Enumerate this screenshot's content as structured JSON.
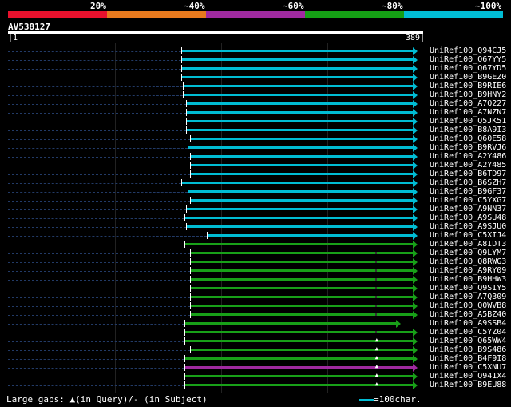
{
  "header": {
    "query_id": "AV538127",
    "start_pos": "1",
    "end_pos": "389",
    "legend": [
      {
        "label": "20%",
        "color": "#e8112d"
      },
      {
        "label": "~40%",
        "color": "#e87a1e"
      },
      {
        "label": "~60%",
        "color": "#a02aa0"
      },
      {
        "label": "~80%",
        "color": "#15a015"
      },
      {
        "label": "~100%",
        "color": "#00bcd4"
      }
    ]
  },
  "colors": {
    "cyan": "#00bcd4",
    "green": "#18a018",
    "purple": "#a02aa0"
  },
  "hits": [
    {
      "name": "UniRef100_Q94CJ5",
      "start": 0.423,
      "color": "cyan"
    },
    {
      "name": "UniRef100_Q67YY5",
      "start": 0.423,
      "color": "cyan"
    },
    {
      "name": "UniRef100_Q67YD5",
      "start": 0.423,
      "color": "cyan"
    },
    {
      "name": "UniRef100_B9GEZ0",
      "start": 0.423,
      "color": "cyan"
    },
    {
      "name": "UniRef100_B9RIE6",
      "start": 0.427,
      "color": "cyan"
    },
    {
      "name": "UniRef100_B9HNY2",
      "start": 0.427,
      "color": "cyan"
    },
    {
      "name": "UniRef100_A7Q227",
      "start": 0.435,
      "color": "cyan"
    },
    {
      "name": "UniRef100_A7NZN7",
      "start": 0.435,
      "color": "cyan"
    },
    {
      "name": "UniRef100_Q5JK51",
      "start": 0.435,
      "color": "cyan"
    },
    {
      "name": "UniRef100_B8A9I3",
      "start": 0.435,
      "color": "cyan"
    },
    {
      "name": "UniRef100_Q60E58",
      "start": 0.445,
      "color": "cyan"
    },
    {
      "name": "UniRef100_B9RVJ6",
      "start": 0.438,
      "color": "cyan"
    },
    {
      "name": "UniRef100_A2Y486",
      "start": 0.445,
      "color": "cyan"
    },
    {
      "name": "UniRef100_A2Y485",
      "start": 0.445,
      "color": "cyan"
    },
    {
      "name": "UniRef100_B6TD97",
      "start": 0.445,
      "color": "cyan"
    },
    {
      "name": "UniRef100_B6SZH7",
      "start": 0.423,
      "color": "cyan"
    },
    {
      "name": "UniRef100_B9GF37",
      "start": 0.438,
      "color": "cyan"
    },
    {
      "name": "UniRef100_C5YXG7",
      "start": 0.445,
      "color": "cyan"
    },
    {
      "name": "UniRef100_A9NN37",
      "start": 0.435,
      "color": "cyan"
    },
    {
      "name": "UniRef100_A9SU48",
      "start": 0.431,
      "color": "cyan"
    },
    {
      "name": "UniRef100_A9SJU0",
      "start": 0.435,
      "color": "cyan"
    },
    {
      "name": "UniRef100_C5XIJ4",
      "start": 0.485,
      "color": "cyan"
    },
    {
      "name": "UniRef100_A8IDT3",
      "start": 0.431,
      "color": "green"
    },
    {
      "name": "UniRef100_Q9LYM7",
      "start": 0.445,
      "color": "green",
      "gap": 0.9
    },
    {
      "name": "UniRef100_Q8RWG3",
      "start": 0.445,
      "color": "green",
      "gap": 0.9
    },
    {
      "name": "UniRef100_A9RY09",
      "start": 0.445,
      "color": "green",
      "gap": 0.9
    },
    {
      "name": "UniRef100_B9HHW3",
      "start": 0.445,
      "color": "green",
      "gap": 0.9
    },
    {
      "name": "UniRef100_Q9SIY5",
      "start": 0.445,
      "color": "green",
      "gap": 0.9
    },
    {
      "name": "UniRef100_A7Q309",
      "start": 0.445,
      "color": "green",
      "gap": 0.9
    },
    {
      "name": "UniRef100_Q0WVB8",
      "start": 0.445,
      "color": "green",
      "gap": 0.9
    },
    {
      "name": "UniRef100_A5BZ40",
      "start": 0.445,
      "color": "green",
      "gap": 0.9
    },
    {
      "name": "UniRef100_A9SSB4",
      "start": 0.431,
      "color": "green",
      "end": 0.96
    },
    {
      "name": "UniRef100_C5YZ04",
      "start": 0.431,
      "color": "green",
      "gap": 0.9
    },
    {
      "name": "UniRef100_Q65WW4",
      "start": 0.431,
      "color": "green",
      "gap": 0.9
    },
    {
      "name": "UniRef100_B9S486",
      "start": 0.445,
      "color": "green",
      "gap": 0.9
    },
    {
      "name": "UniRef100_B4F9I8",
      "start": 0.431,
      "color": "green",
      "gap": 0.9
    },
    {
      "name": "UniRef100_C5XNU7",
      "start": 0.431,
      "color": "purple",
      "gap": 0.9
    },
    {
      "name": "UniRef100_Q941X4",
      "start": 0.431,
      "color": "green",
      "gap": 0.9
    },
    {
      "name": "UniRef100_B9EU88",
      "start": 0.431,
      "color": "green",
      "gap": 0.9
    }
  ],
  "footer": {
    "gaps_text": "Large gaps: ▲(in Query)/- (in Subject)",
    "scale_text": "=100char."
  }
}
